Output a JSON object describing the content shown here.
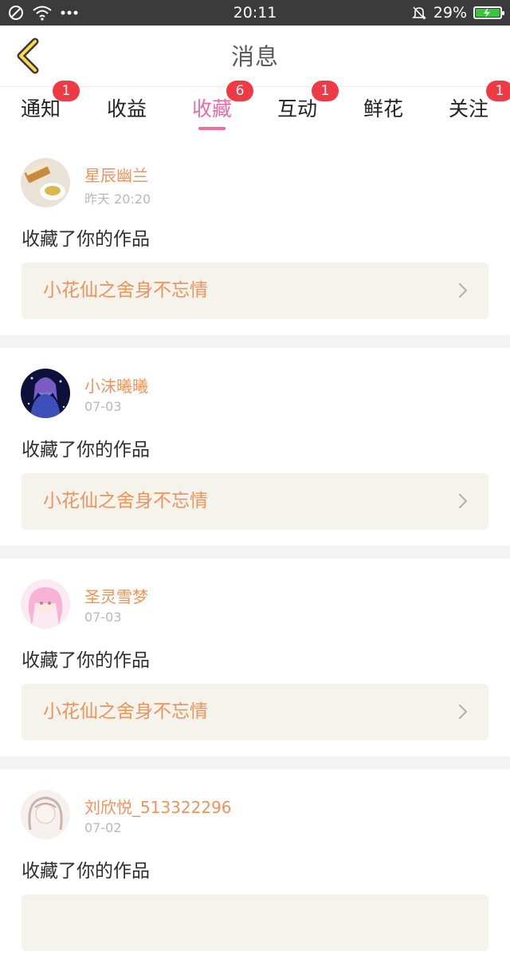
{
  "status_bar": {
    "time": "20:11",
    "battery": "29%",
    "battery_color": "#37c53a"
  },
  "header": {
    "title": "消息",
    "back_icon": "chevron-left-icon"
  },
  "tabs": [
    {
      "label": "通知",
      "badge": "1"
    },
    {
      "label": "收益",
      "badge": ""
    },
    {
      "label": "收藏",
      "badge": "6",
      "active": true
    },
    {
      "label": "互动",
      "badge": "1"
    },
    {
      "label": "鲜花",
      "badge": ""
    },
    {
      "label": "关注",
      "badge": "1"
    }
  ],
  "colors": {
    "accent": "#f06aa4",
    "username": "#f0935a",
    "badge": "#ee3a45"
  },
  "items": [
    {
      "user": "星辰幽兰",
      "time": "昨天 20:20",
      "action": "收藏了你的作品",
      "work": "小花仙之舍身不忘情"
    },
    {
      "user": "小沫曦曦",
      "time": "07-03",
      "action": "收藏了你的作品",
      "work": "小花仙之舍身不忘情"
    },
    {
      "user": "圣灵雪梦",
      "time": "07-03",
      "action": "收藏了你的作品",
      "work": "小花仙之舍身不忘情"
    },
    {
      "user": "刘欣悦_513322296",
      "time": "07-02",
      "action": "收藏了你的作品",
      "work": ""
    }
  ]
}
